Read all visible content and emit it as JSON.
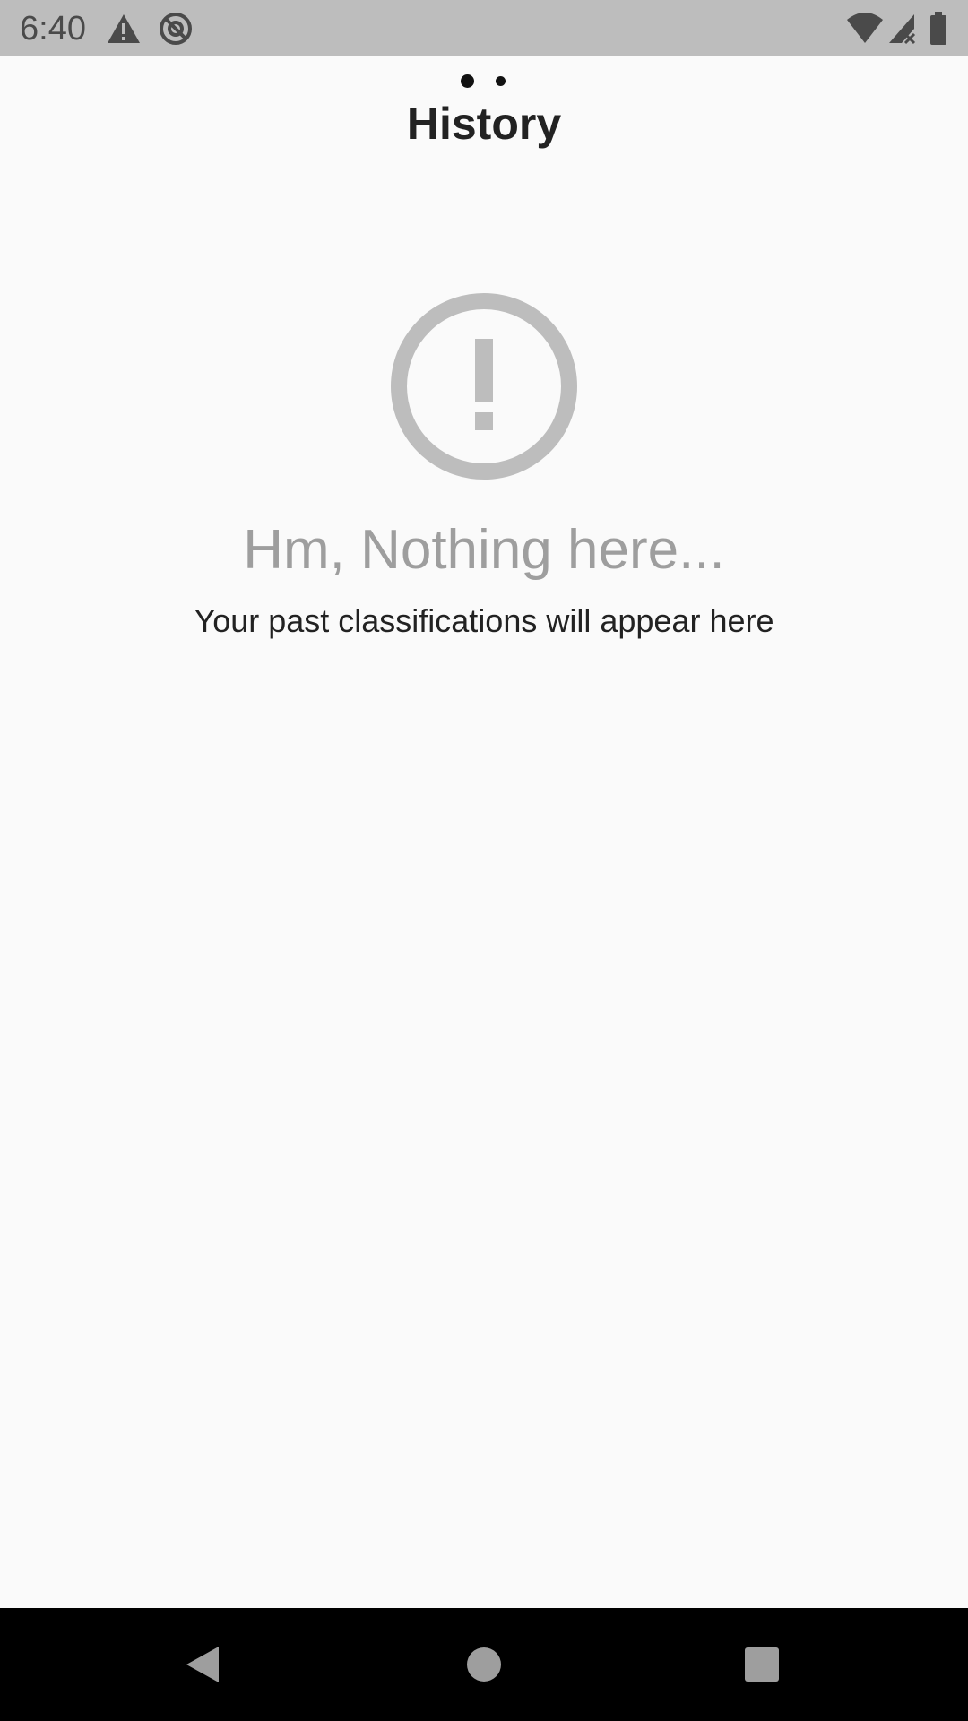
{
  "status_bar": {
    "time": "6:40",
    "icons": [
      "warning-icon",
      "no-sync-icon",
      "wifi-icon",
      "signal-icon",
      "battery-icon"
    ]
  },
  "pager": {
    "page_count": 2,
    "current_page": 1
  },
  "header": {
    "title": "History"
  },
  "empty_state": {
    "icon": "alert-circle-icon",
    "title": "Hm, Nothing here...",
    "subtitle": "Your past classifications will appear here"
  },
  "nav_bar": {
    "icons": [
      "back-icon",
      "home-icon",
      "recents-icon"
    ]
  },
  "colors": {
    "status_bar_bg": "#bdbdbd",
    "background": "#fafafa",
    "icon_gray": "#bdbdbd",
    "muted_text": "#9e9e9e",
    "nav_bar_bg": "#000000"
  }
}
